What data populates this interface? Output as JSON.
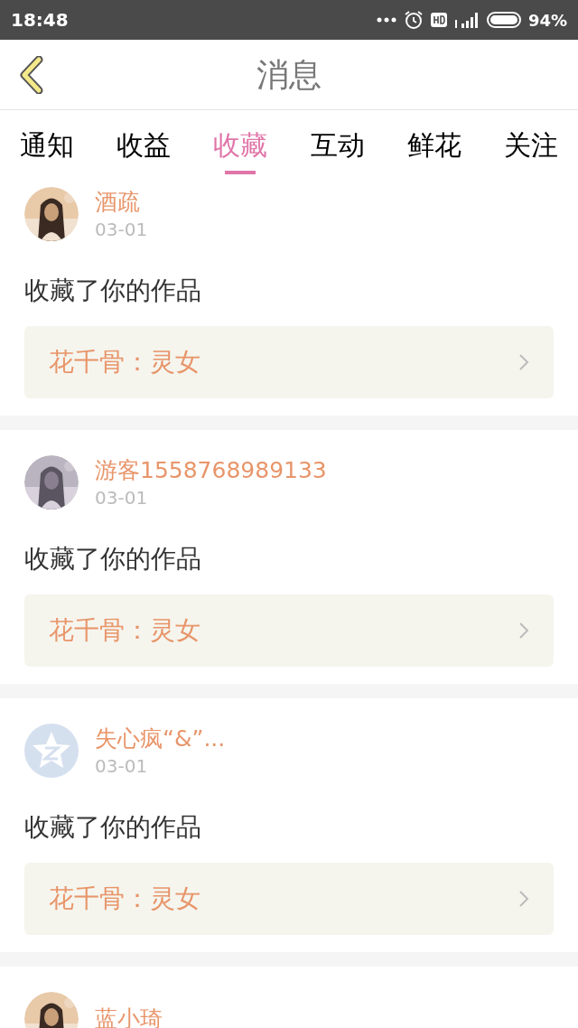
{
  "status_bar": {
    "time": "18:48",
    "battery": "94%"
  },
  "header": {
    "title": "消息"
  },
  "tabs": [
    {
      "label": "通知",
      "selected": false
    },
    {
      "label": "收益",
      "selected": false
    },
    {
      "label": "收藏",
      "selected": true
    },
    {
      "label": "互动",
      "selected": false
    },
    {
      "label": "鲜花",
      "selected": false
    },
    {
      "label": "关注",
      "selected": false
    }
  ],
  "messages": [
    {
      "name": "酒疏",
      "date": "03-01",
      "action": "收藏了你的作品",
      "work": "花千骨：灵女"
    },
    {
      "name": "游客1558768989133",
      "date": "03-01",
      "action": "收藏了你的作品",
      "work": "花千骨：灵女"
    },
    {
      "avatar": {
        "kind": "default"
      },
      "name": "失心疯“&”...",
      "date": "03-01",
      "action": "收藏了你的作品",
      "work": "花千骨：灵女"
    },
    {
      "name": "蓝小琦"
    }
  ]
}
